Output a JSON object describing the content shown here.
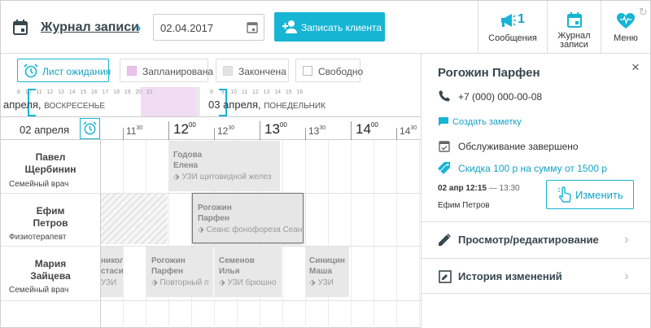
{
  "header": {
    "title": "Журнал записи",
    "date_value": "02.04.2017",
    "add_client_label": "Записать клиента",
    "messages_count": "1",
    "messages_label": "Сообщения",
    "journal_label_1": "Журнал",
    "journal_label_2": "записи",
    "menu_label": "Меню"
  },
  "legend": {
    "waiting_list": "Лист ожидания",
    "planned": "Запланирована",
    "finished": "Закончена",
    "free": "Свободно"
  },
  "day_strip": {
    "left_nums": "8   10   11   12   13   14   15   16   17   18   19   20   21",
    "left_day": "апреля,",
    "left_weekday": "ВОСКРЕСЕНЬЕ",
    "right_nums": "8     9    10   11   12   13   14   15   16",
    "right_day": "03 апреля,",
    "right_weekday": "ПОНЕДЕЛЬНИК"
  },
  "timeline": {
    "current_date": "02 апреля",
    "hours": [
      {
        "h": "11",
        "m": "30",
        "big": false
      },
      {
        "h": "12",
        "m": "00",
        "big": true
      },
      {
        "h": "12",
        "m": "30",
        "big": false
      },
      {
        "h": "13",
        "m": "00",
        "big": true
      },
      {
        "h": "13",
        "m": "30",
        "big": false
      },
      {
        "h": "14",
        "m": "00",
        "big": true
      },
      {
        "h": "14",
        "m": "30",
        "big": false
      }
    ]
  },
  "doctors": [
    {
      "first": "Павел",
      "last": "Щербинин",
      "role": "Семейный врач"
    },
    {
      "first": "Ефим",
      "last": "Петров",
      "role": "Физиотерапевт"
    },
    {
      "first": "Мария",
      "last": "Зайцева",
      "role": "Семейный врач"
    }
  ],
  "appointments": [
    {
      "n1": "Годова",
      "n2": "Елена",
      "svc": "УЗИ щитовидной желез"
    },
    {
      "n1": "Рогожин",
      "n2": "Парфен",
      "svc": "Сеанс фонофореза Сеан"
    },
    {
      "n1": "никол",
      "n2": "стаси",
      "svc": "УЗИ"
    },
    {
      "n1": "Рогожин",
      "n2": "Парфен",
      "svc": "Повторный п"
    },
    {
      "n1": "Семенов",
      "n2": "Илья",
      "svc": "УЗИ брюшно"
    },
    {
      "n1": "Синицин",
      "n2": "Маша",
      "svc": "УЗИ"
    }
  ],
  "panel": {
    "client_name": "Рогожин Парфен",
    "phone": "+7 (000) 000-00-08",
    "create_note": "Создать заметку",
    "status": "Обслуживание завершено",
    "discount": "Скидка 100 р на сумму от 1500 р",
    "appt_date": "02 апр",
    "appt_start": "12:15",
    "appt_end": "— 13:30",
    "appt_doctor": "Ефим Петров",
    "edit_label": "Изменить",
    "view_edit_label": "Просмотр/редактирование",
    "history_label": "История изменений",
    "close": "×"
  },
  "colors": {
    "accent": "#16b5d4",
    "planned": "#e8c4ec",
    "finished": "#e3e3e3",
    "text": "#37474f"
  }
}
